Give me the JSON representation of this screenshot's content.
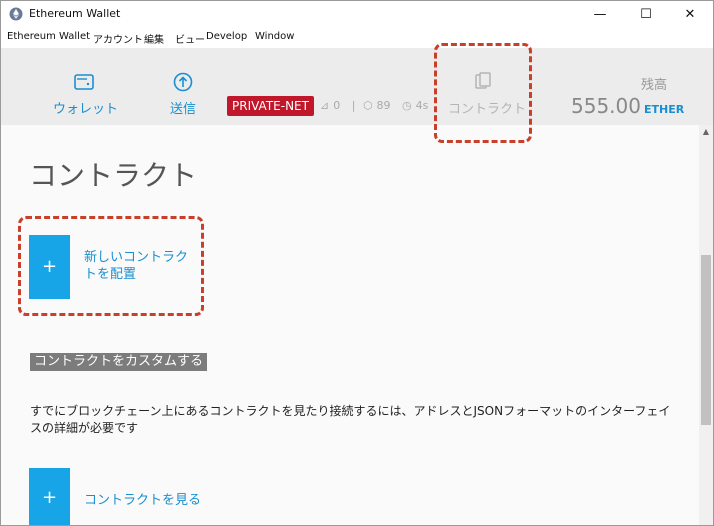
{
  "window": {
    "title": "Ethereum Wallet",
    "controls": {
      "minimize": "—",
      "maximize": "☐",
      "close": "✕"
    }
  },
  "menu": [
    "Ethereum Wallet",
    "アカウント",
    "編集",
    "ビュー",
    "Develop",
    "Window"
  ],
  "header": {
    "nav": {
      "wallets": {
        "label": "ウォレット",
        "icon": "wallet-icon"
      },
      "send": {
        "label": "送信",
        "icon": "arrow-up-circle-icon"
      },
      "contracts": {
        "label": "コントラクト",
        "icon": "document-icon"
      }
    },
    "network_badge": "PRIVATE-NET",
    "stats": {
      "peers": "0",
      "separator": "|",
      "block": "89",
      "time": "4s"
    },
    "balance": {
      "label": "残高",
      "amount": "555.00",
      "unit": "ETHER"
    }
  },
  "main": {
    "title": "コントラクト",
    "deploy": {
      "plus": "+",
      "label": "新しいコントラクトを配置"
    },
    "custom_section": "コントラクトをカスタムする",
    "custom_desc": "すでにブロックチェーン上にあるコントラクトを見たり接続するには、アドレスとJSONフォーマットのインターフェイスの詳細が必要です",
    "watch": {
      "plus": "+",
      "label": "コントラクトを見る"
    }
  },
  "colors": {
    "accent": "#1a8fcf",
    "button_blue": "#17a5e8",
    "badge_red": "#c0172b",
    "annotation": "#c8402a"
  }
}
